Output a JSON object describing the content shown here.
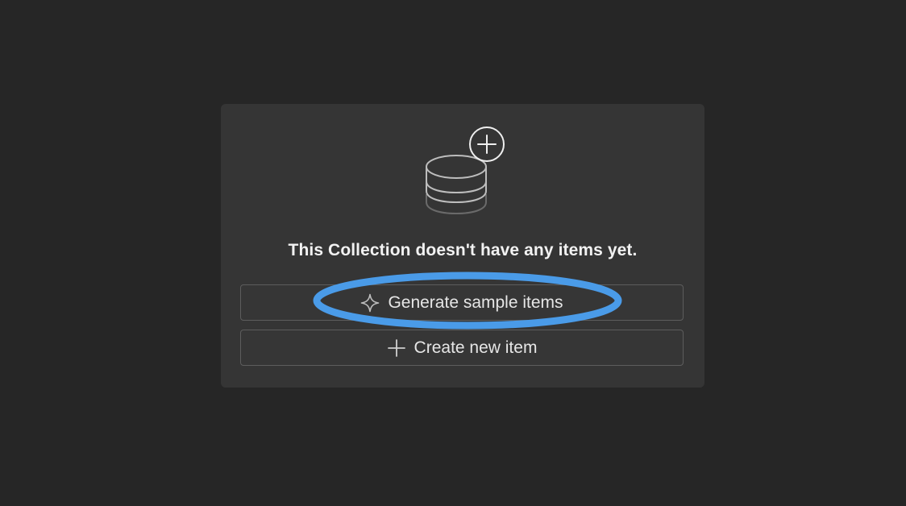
{
  "empty_state": {
    "message": "This Collection doesn't have any items yet.",
    "illustration_icon": "database-plus-icon",
    "actions": {
      "generate": {
        "label": "Generate sample items",
        "icon": "sparkle-icon"
      },
      "create": {
        "label": "Create new item",
        "icon": "plus-icon"
      }
    }
  },
  "colors": {
    "background": "#262626",
    "card": "#353535",
    "highlight": "#4a9be8"
  }
}
